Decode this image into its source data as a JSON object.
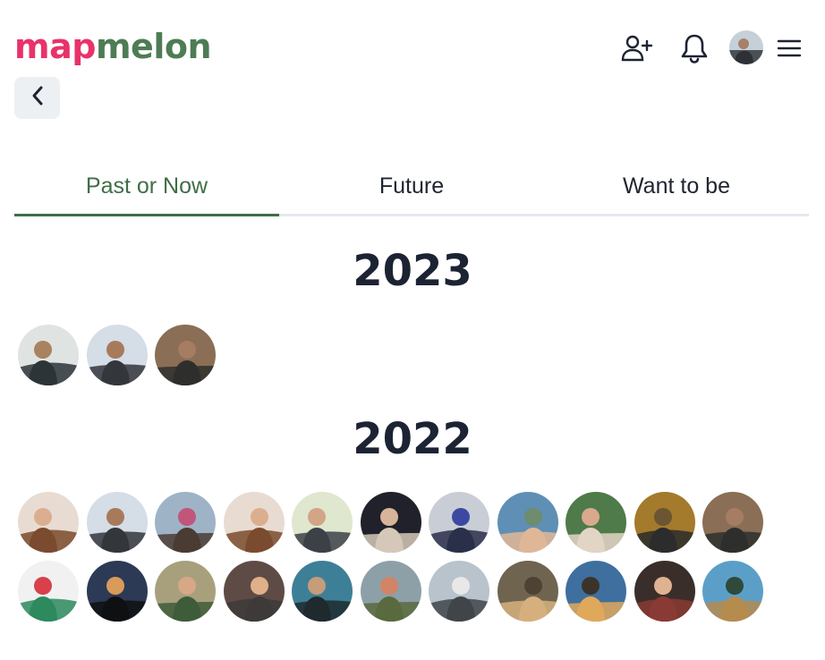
{
  "header": {
    "logo": {
      "part1": "map",
      "part2": "melon"
    },
    "icons": [
      "add-user-icon",
      "bell-icon",
      "avatar",
      "menu-icon"
    ]
  },
  "nav": {
    "back_icon": "chevron-left-icon"
  },
  "tabs": [
    {
      "label": "Past or Now",
      "active": true
    },
    {
      "label": "Future",
      "active": false
    },
    {
      "label": "Want to be",
      "active": false
    }
  ],
  "colors": {
    "brand_pink": "#e8336a",
    "brand_green": "#4e7c54",
    "active_tab": "#3f6e46"
  },
  "sections": [
    {
      "year": "2023",
      "photos": [
        [
          "#dfe3e2",
          "#2d3438",
          "#a9825f"
        ],
        [
          "#d5dde6",
          "#33363b",
          "#a87a5c"
        ],
        [
          "#8a6e55",
          "#2e2f2d",
          "#a67d62"
        ]
      ]
    },
    {
      "year": "2022",
      "photos": [
        [
          "#e8dcd2",
          "#7a4b2e",
          "#dcae90"
        ],
        [
          "#d5dde6",
          "#33363b",
          "#a87a5c"
        ],
        [
          "#9fb3c6",
          "#4a3b33",
          "#c1557a"
        ],
        [
          "#e8dcd2",
          "#7a4b2e",
          "#dcae90"
        ],
        [
          "#dfe7cf",
          "#3c4148",
          "#d2a587"
        ],
        [
          "#20212a",
          "#d6c8b8",
          "#d8b49a"
        ],
        [
          "#c9ced6",
          "#2a2f4a",
          "#3b4aa0"
        ],
        [
          "#5f8fb4",
          "#e0b796",
          "#6e8c6e"
        ],
        [
          "#4f7a49",
          "#e3d5c6",
          "#d9a98d"
        ],
        [
          "#a47a2c",
          "#2c2c2c",
          "#6b5532"
        ],
        [
          "#8a6e55",
          "#2e2f2d",
          "#a67d62"
        ],
        [
          "#f1f1f1",
          "#2c8a5e",
          "#d8404a"
        ],
        [
          "#2c3a55",
          "#0f1012",
          "#d99a5a"
        ],
        [
          "#a8a07c",
          "#3f5c3a",
          "#d6a886"
        ],
        [
          "#5e4b45",
          "#3d3a39",
          "#e0b088"
        ],
        [
          "#3e7f98",
          "#1e2a2e",
          "#c69c7a"
        ],
        [
          "#8da0a8",
          "#596a3e",
          "#d28466"
        ],
        [
          "#b8c3cc",
          "#404549",
          "#e8e8e8"
        ],
        [
          "#6e6450",
          "#d6b07c",
          "#4d4233"
        ],
        [
          "#3f6f9f",
          "#e0a85a",
          "#3b332a"
        ],
        [
          "#3a2e2a",
          "#8a3a34",
          "#dfb292"
        ],
        [
          "#5b9fc8",
          "#b58b4e",
          "#2f4a3a"
        ]
      ]
    }
  ]
}
